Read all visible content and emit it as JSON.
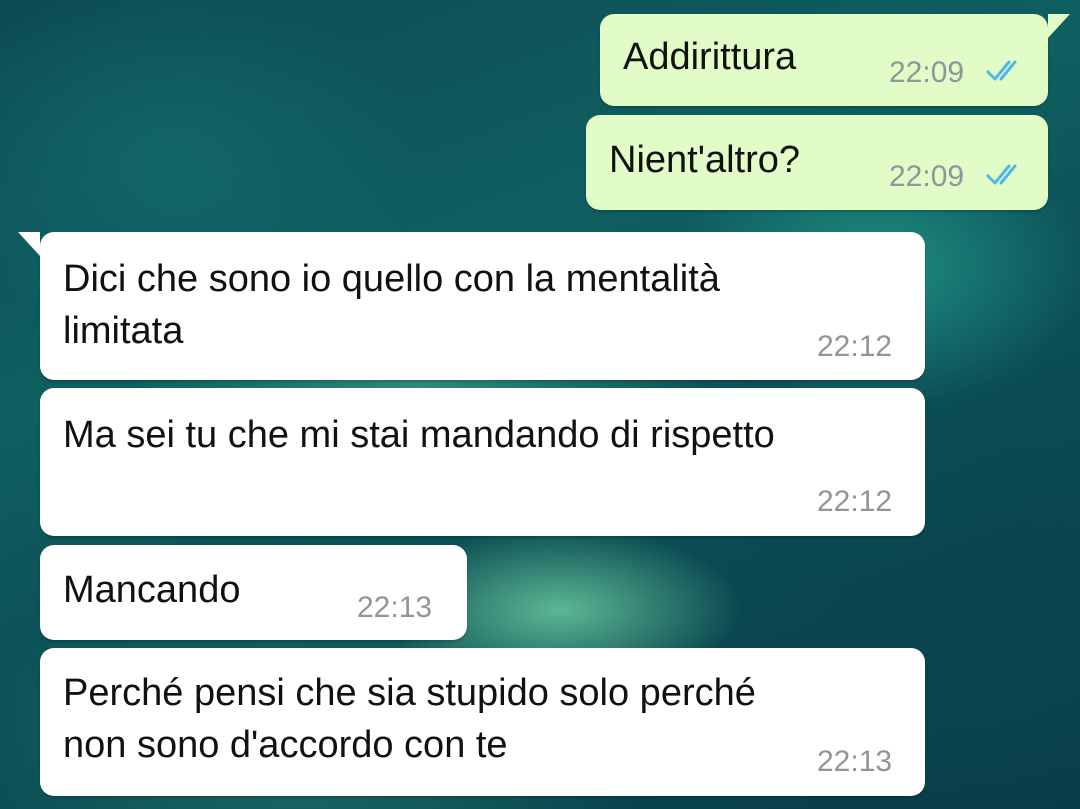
{
  "chat": {
    "messages": [
      {
        "direction": "outgoing",
        "text": "Addirittura",
        "time": "22:09",
        "status": "read"
      },
      {
        "direction": "outgoing",
        "text": "Nient'altro?",
        "time": "22:09",
        "status": "read"
      },
      {
        "direction": "incoming",
        "lines": [
          "Dici che sono io quello con la mentalità",
          "limitata"
        ],
        "time": "22:12"
      },
      {
        "direction": "incoming",
        "text": "Ma sei tu che mi stai mandando di rispetto",
        "time": "22:12"
      },
      {
        "direction": "incoming",
        "text": "Mancando",
        "time": "22:13"
      },
      {
        "direction": "incoming",
        "lines": [
          "Perché pensi che sia stupido solo perché",
          "non sono d'accordo con te"
        ],
        "time": "22:13"
      }
    ]
  },
  "colors": {
    "outgoing_bubble": "#e1fcc6",
    "incoming_bubble": "#ffffff",
    "read_ticks": "#4fb6ec",
    "timestamp": "#8f969a"
  },
  "icons": {
    "read_receipt": "double-check-icon"
  }
}
